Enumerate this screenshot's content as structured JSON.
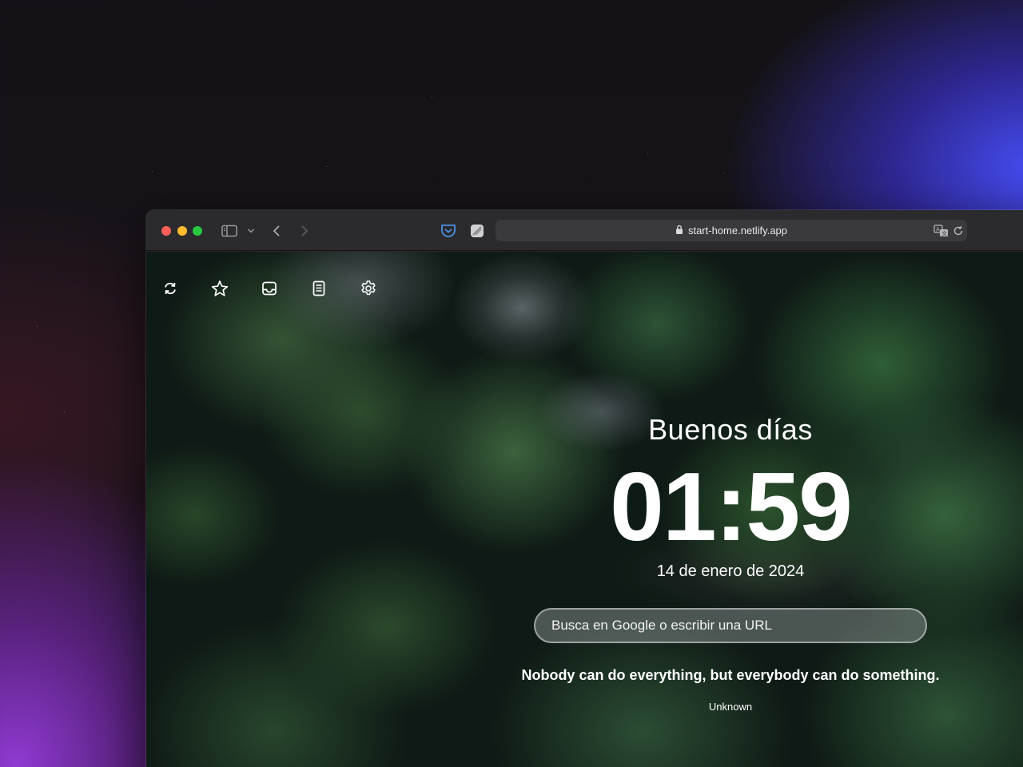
{
  "browser": {
    "url": "start-home.netlify.app",
    "icons": {
      "sidebar_toggle": "sidebar-icon",
      "sidebar_menu": "chevron-down-icon",
      "back": "chevron-left-icon",
      "forward": "chevron-right-icon",
      "pocket": "pocket-icon",
      "extension": "extension-icon",
      "secure": "lock-icon",
      "translate": "translate-icon",
      "reload": "reload-icon"
    },
    "traffic_lights": {
      "close": "#ff5f57",
      "minimize": "#febc2e",
      "zoom": "#28c840"
    }
  },
  "page": {
    "toolbar": [
      {
        "name": "refresh-icon"
      },
      {
        "name": "star-icon"
      },
      {
        "name": "inbox-icon"
      },
      {
        "name": "document-icon"
      },
      {
        "name": "gear-icon"
      }
    ],
    "greeting": "Buenos días",
    "clock": "01:59",
    "date": "14 de enero de 2024",
    "search": {
      "placeholder": "Busca en Google o escribir una URL"
    },
    "quote": {
      "text": "Nobody can do everything, but everybody can do something.",
      "author": "Unknown"
    }
  },
  "colors": {
    "text": "#ffffff",
    "pocket": "#4a90e2"
  }
}
